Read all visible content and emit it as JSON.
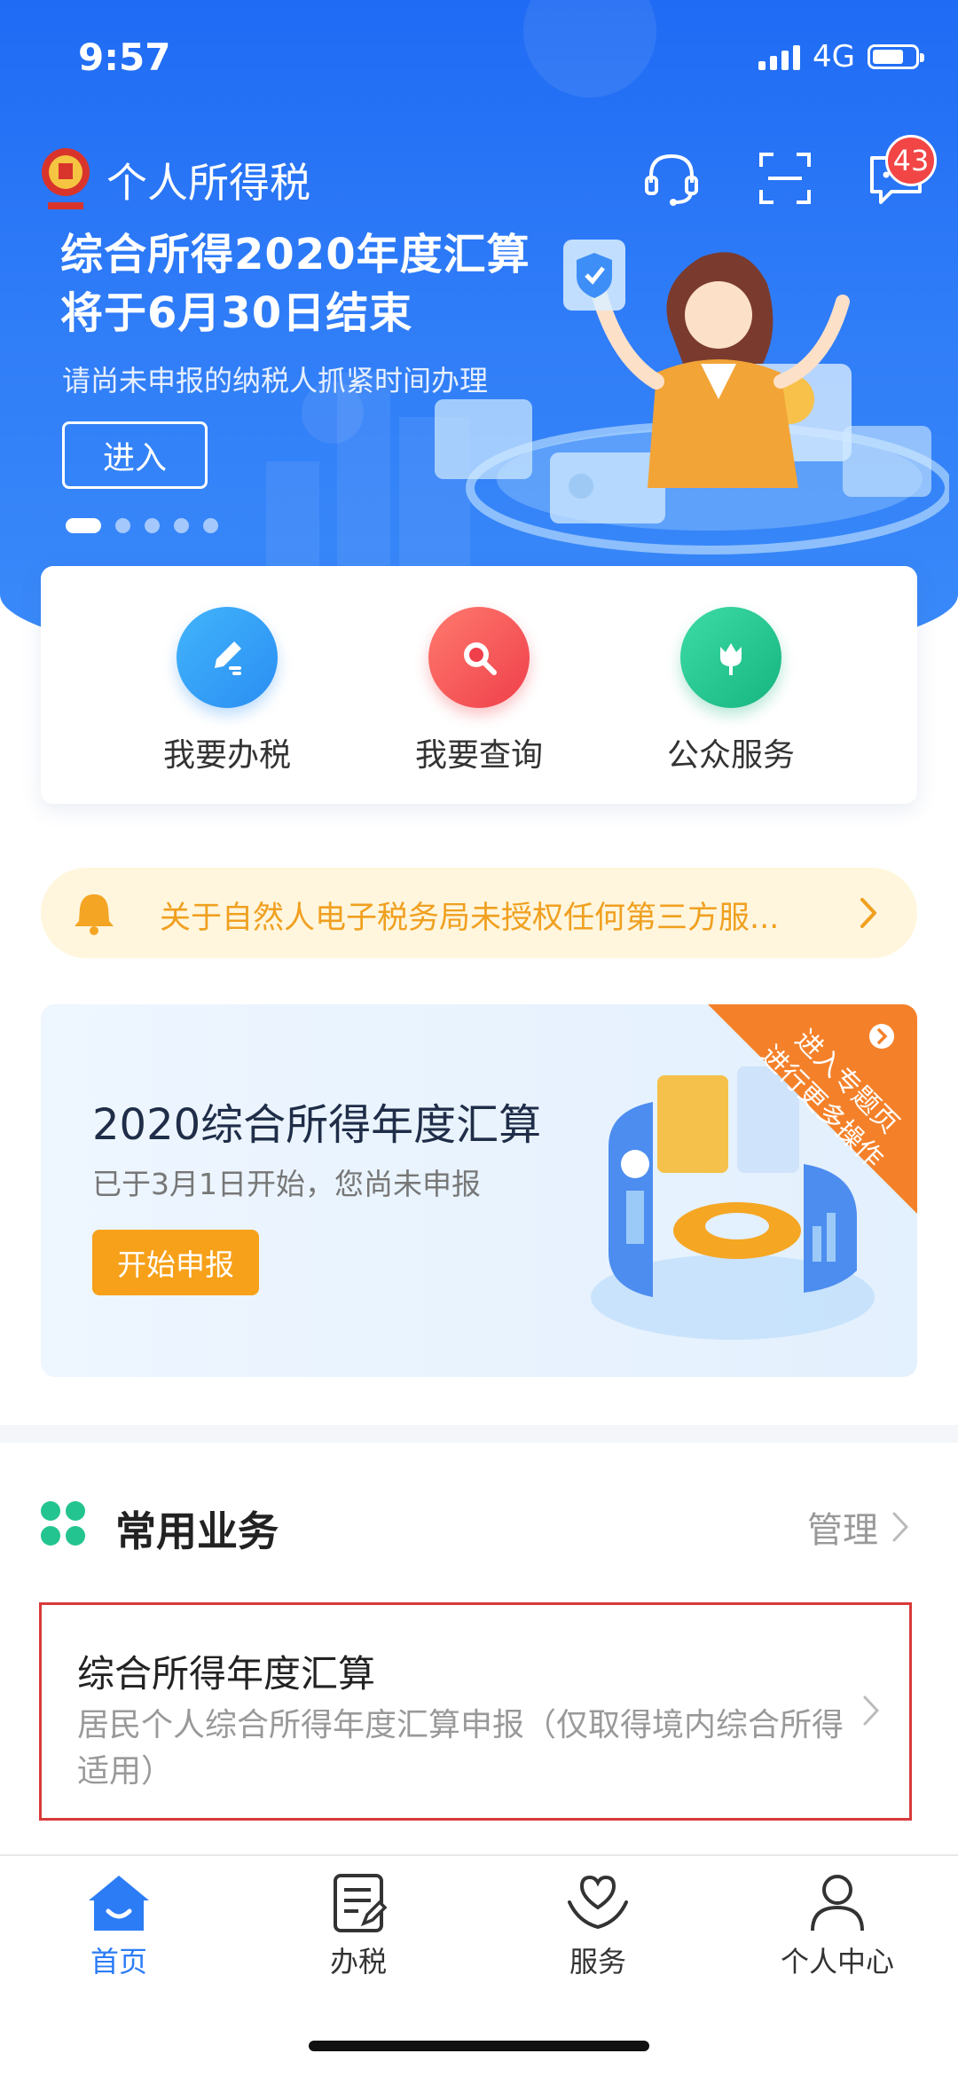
{
  "status_bar": {
    "time": "9:57",
    "network": "4G"
  },
  "header": {
    "app_title": "个人所得税",
    "message_badge": "43"
  },
  "banner": {
    "title_line1": "综合所得2020年度汇算",
    "title_line2": "将于6月30日结束",
    "subtitle": "请尚未申报的纳税人抓紧时间办理",
    "enter_label": "进入",
    "page_count": 5,
    "active_page": 1
  },
  "quick_actions": [
    {
      "label": "我要办税",
      "icon": "edit-icon",
      "color": "#2f9bf5"
    },
    {
      "label": "我要查询",
      "icon": "magnifier-icon",
      "color": "#f0474a"
    },
    {
      "label": "公众服务",
      "icon": "tulip-icon",
      "color": "#1fc08c"
    }
  ],
  "notice": {
    "text": "关于自然人电子税务局未授权任何第三方服..."
  },
  "promo": {
    "title": "2020综合所得年度汇算",
    "subtitle": "已于3月1日开始，您尚未申报",
    "start_label": "开始申报",
    "ribbon_line1": "进入专题页",
    "ribbon_line2": "进行更多操作"
  },
  "common_business": {
    "title": "常用业务",
    "manage_label": "管理",
    "items": [
      {
        "title": "综合所得年度汇算",
        "desc": "居民个人综合所得年度汇算申报（仅取得境内综合所得适用）"
      }
    ]
  },
  "tabs": [
    {
      "label": "首页",
      "icon": "home-icon",
      "active": true
    },
    {
      "label": "办税",
      "icon": "document-icon",
      "active": false
    },
    {
      "label": "服务",
      "icon": "heart-hand-icon",
      "active": false
    },
    {
      "label": "个人中心",
      "icon": "person-icon",
      "active": false
    }
  ],
  "colors": {
    "brand_blue": "#2c7cf6",
    "accent_orange": "#f7a11a",
    "notice_text": "#f0a020",
    "highlight_red": "#d93a3a"
  }
}
